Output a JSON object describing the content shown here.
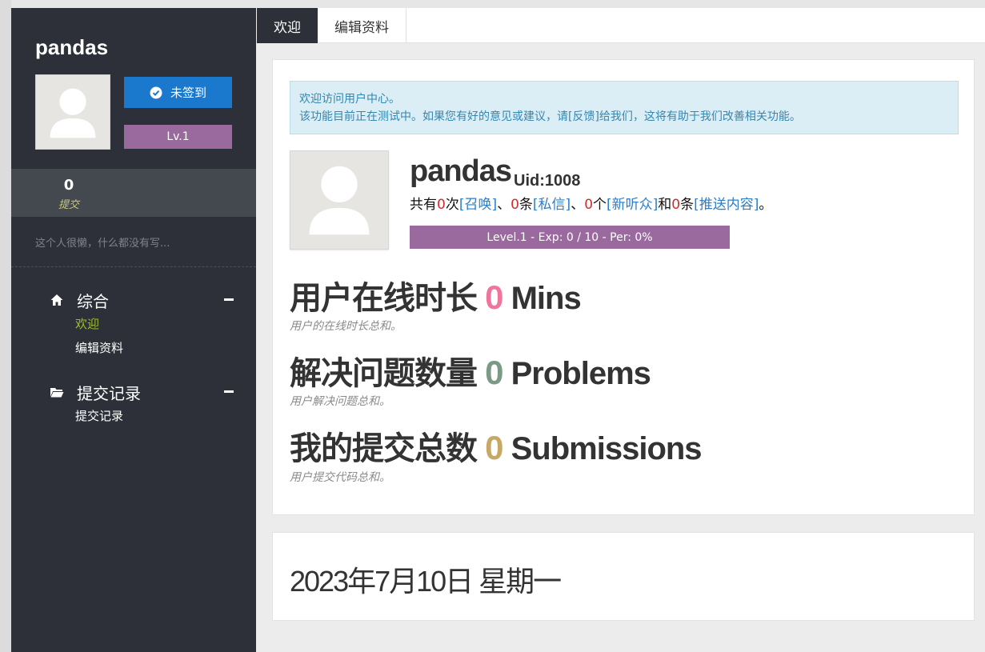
{
  "sidebar": {
    "username": "pandas",
    "checkin_label": "未签到",
    "level_label": "Lv.1",
    "stat": {
      "value": "0",
      "label": "提交"
    },
    "bio": "这个人很懒，什么都没有写...",
    "nav": [
      {
        "label": "综合",
        "icon": "home-icon",
        "items": [
          {
            "label": "欢迎",
            "active": true
          },
          {
            "label": "编辑资料",
            "active": false
          }
        ]
      },
      {
        "label": "提交记录",
        "icon": "folder-icon",
        "items": [
          {
            "label": "提交记录",
            "active": false
          }
        ]
      }
    ]
  },
  "tabs": [
    {
      "label": "欢迎",
      "active": true
    },
    {
      "label": "编辑资料",
      "active": false
    }
  ],
  "alert": {
    "line1": "欢迎访问用户中心。",
    "line2": "该功能目前正在测试中。如果您有好的意见或建议，请[反馈]给我们，这将有助于我们改善相关功能。"
  },
  "profile": {
    "name": "pandas",
    "uid": "Uid:1008",
    "summary": {
      "p1": "共有",
      "summon_count": "0",
      "p2": "次",
      "summon_link": "[召唤]",
      "p3": "、",
      "pm_count": "0",
      "p4": "条",
      "pm_link": "[私信]",
      "p5": "、",
      "fans_count": "0",
      "p6": "个",
      "fans_link": "[新听众]",
      "p7": "和",
      "push_count": "0",
      "p8": "条",
      "push_link": "[推送内容]",
      "p9": "。"
    },
    "exp_bar_label": "Level.1 - Exp: 0 / 10 - Per: 0%",
    "exp_fraction": 0
  },
  "metrics": [
    {
      "title": "用户在线时长",
      "value": "0",
      "unit": "Mins",
      "color": "#f0749c",
      "desc": "用户的在线时长总和。"
    },
    {
      "title": "解决问题数量",
      "value": "0",
      "unit": "Problems",
      "color": "#7a9a85",
      "desc": "用户解决问题总和。"
    },
    {
      "title": "我的提交总数",
      "value": "0",
      "unit": "Submissions",
      "color": "#c8a865",
      "desc": "用户提交代码总和。"
    }
  ],
  "date": "2023年7月10日 星期一",
  "colors": {
    "sidebar_bg": "#2d3038",
    "checkin_blue": "#1a79cc",
    "level_purple": "#9a6a9f",
    "active_nav": "#9bbf2a"
  }
}
